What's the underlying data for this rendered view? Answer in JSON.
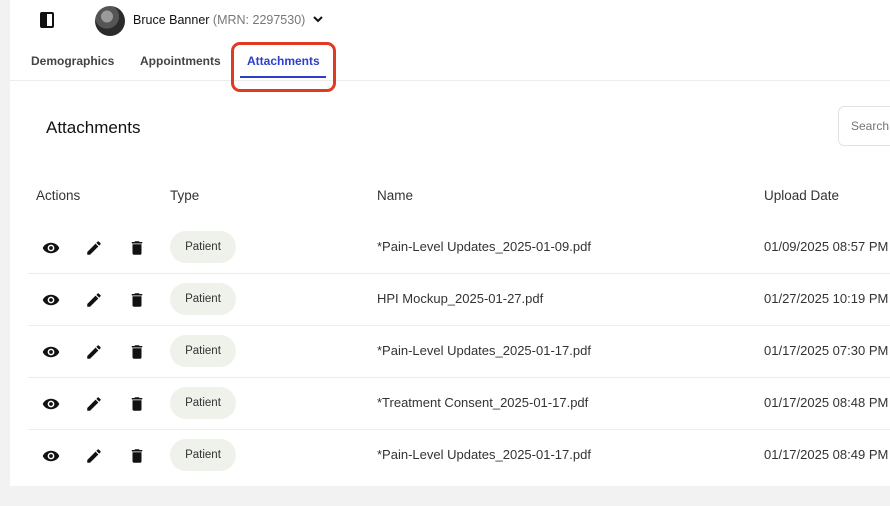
{
  "header": {
    "patient_name": "Bruce Banner",
    "patient_mrn": "(MRN: 2297530)"
  },
  "tabs": [
    {
      "label": "Demographics",
      "active": false
    },
    {
      "label": "Appointments",
      "active": false
    },
    {
      "label": "Attachments",
      "active": true
    }
  ],
  "section": {
    "title": "Attachments",
    "search_placeholder": "Search"
  },
  "table": {
    "headers": [
      "Actions",
      "Type",
      "Name",
      "Upload Date"
    ],
    "rows": [
      {
        "type": "Patient",
        "name": "*Pain-Level Updates_2025-01-09.pdf",
        "upload_date": "01/09/2025 08:57 PM"
      },
      {
        "type": "Patient",
        "name": "HPI Mockup_2025-01-27.pdf",
        "upload_date": "01/27/2025 10:19 PM"
      },
      {
        "type": "Patient",
        "name": "*Pain-Level Updates_2025-01-17.pdf",
        "upload_date": "01/17/2025 07:30 PM"
      },
      {
        "type": "Patient",
        "name": "*Treatment Consent_2025-01-17.pdf",
        "upload_date": "01/17/2025 08:48 PM"
      },
      {
        "type": "Patient",
        "name": "*Pain-Level Updates_2025-01-17.pdf",
        "upload_date": "01/17/2025 08:49 PM"
      }
    ],
    "row_actions": [
      "eye-icon",
      "pencil-icon",
      "trash-icon"
    ]
  },
  "colors": {
    "accent": "#2d3fc8",
    "highlight": "#e03a22",
    "badge_bg": "#eef2eb",
    "page_bg": "#f2f2f2"
  }
}
